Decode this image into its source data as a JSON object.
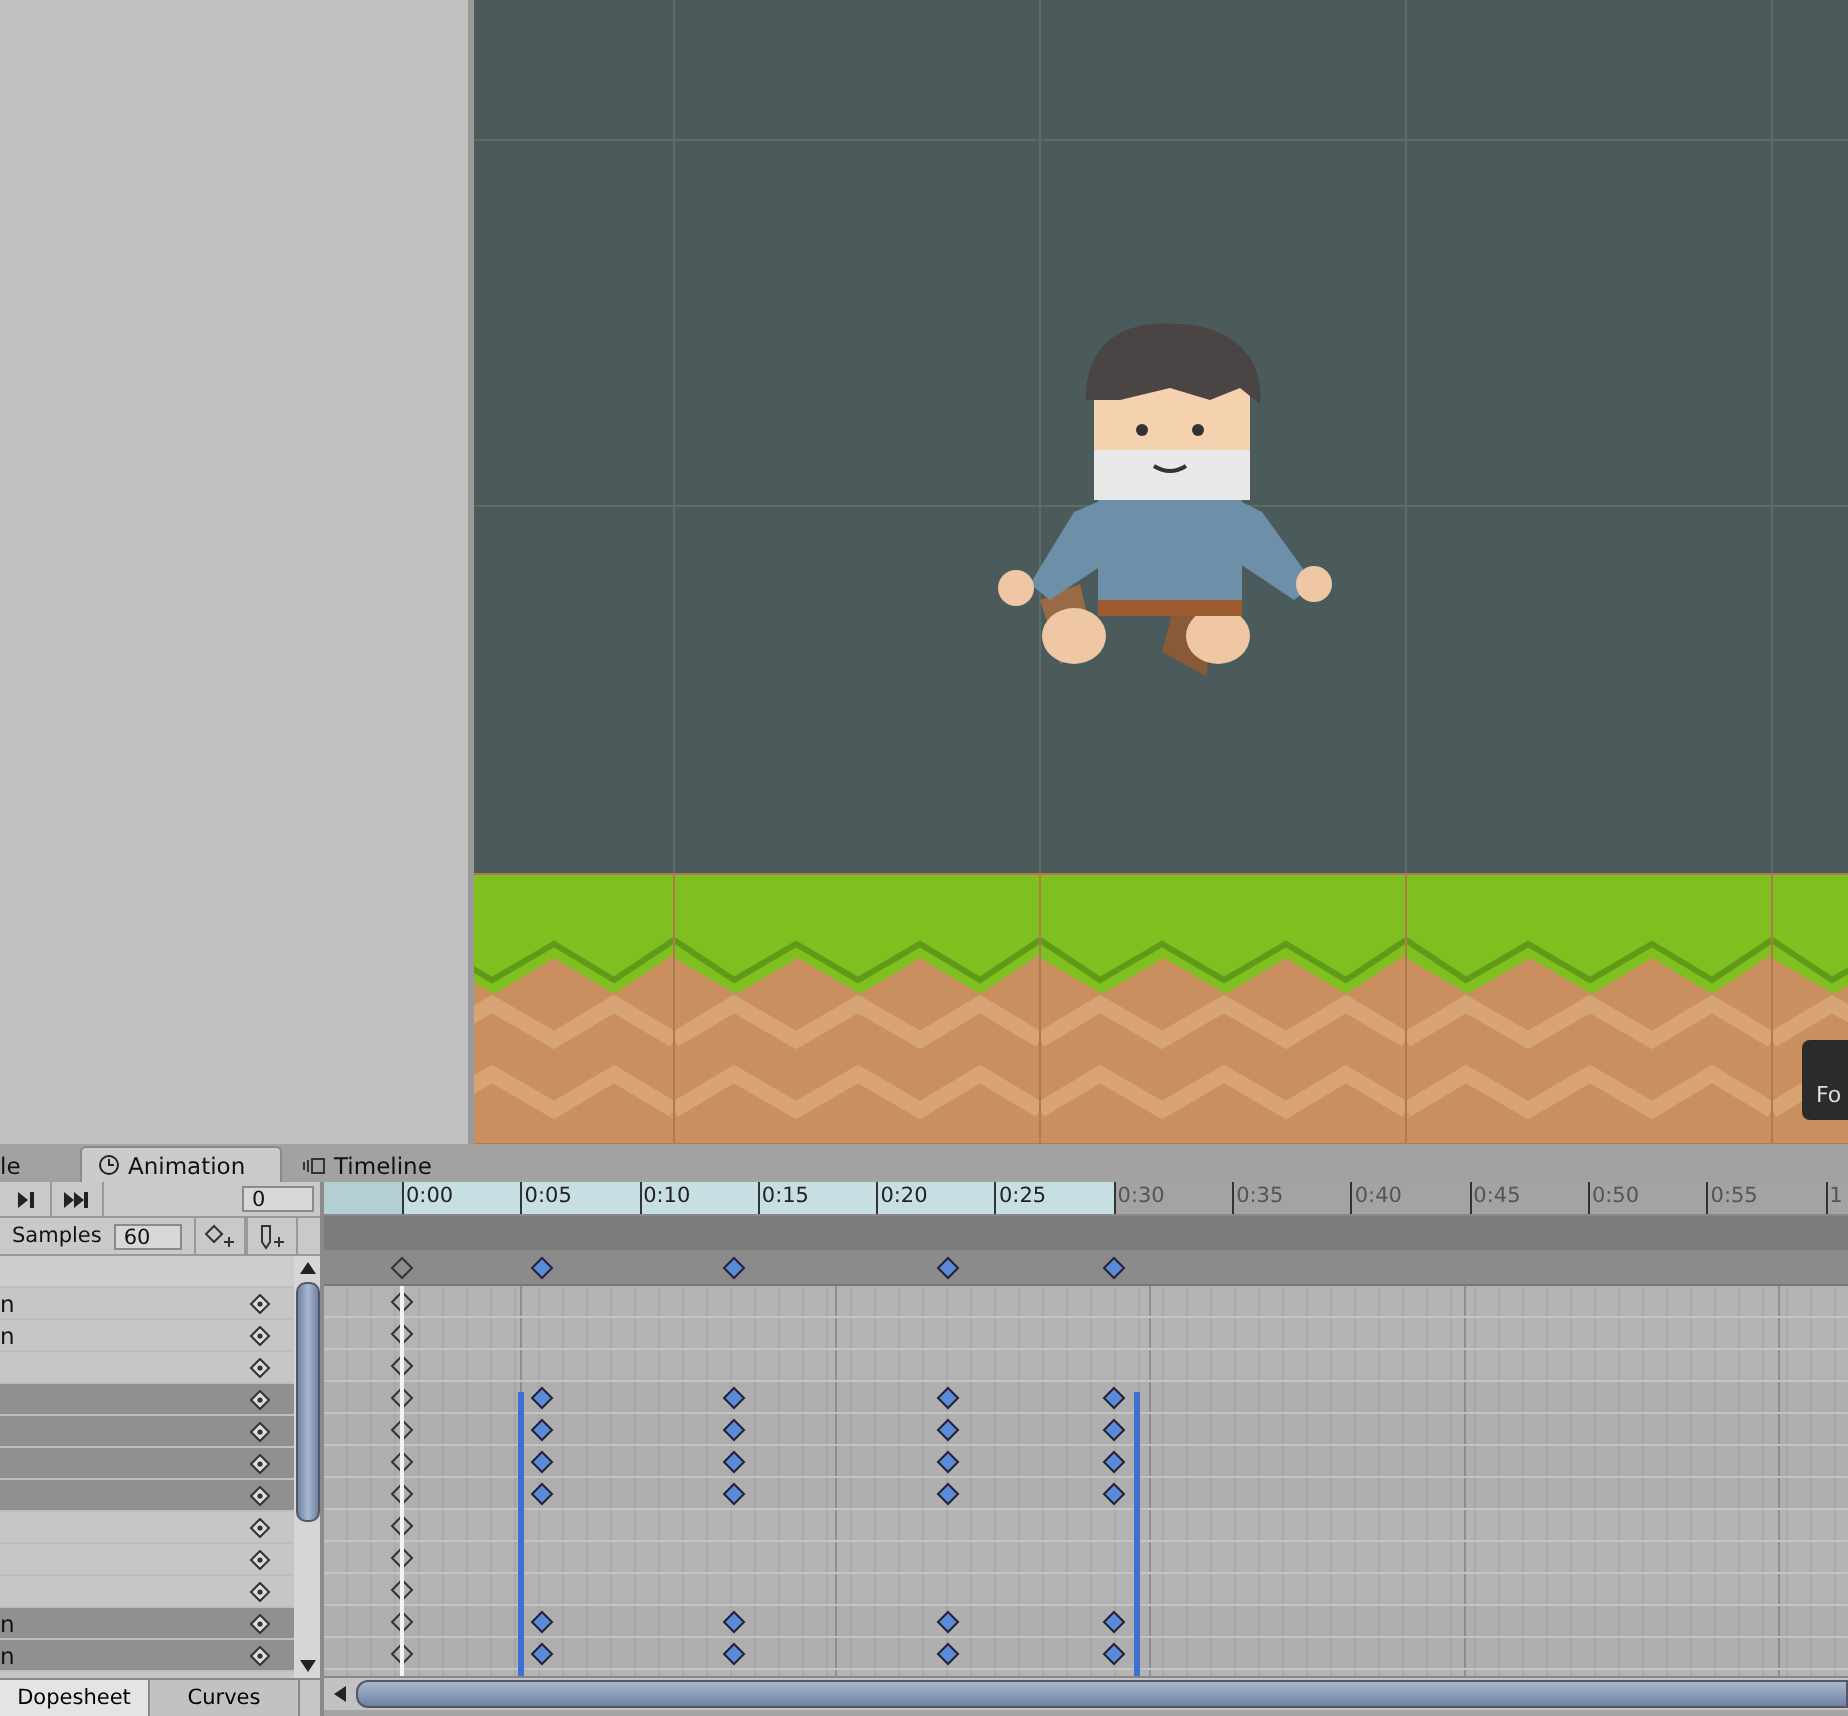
{
  "scene": {
    "tooltip": "Fo"
  },
  "tabs": [
    {
      "label": "le",
      "kind": "plain",
      "selected": false
    },
    {
      "label": "Animation",
      "kind": "clock",
      "selected": true
    },
    {
      "label": "Timeline",
      "kind": "timeline",
      "selected": false
    }
  ],
  "toolbar": {
    "frame": "0",
    "samples_label": "Samples",
    "samples": "60"
  },
  "ruler": [
    {
      "text": "0:00",
      "in_clip": true
    },
    {
      "text": "0:05",
      "in_clip": true
    },
    {
      "text": "0:10",
      "in_clip": true
    },
    {
      "text": "0:15",
      "in_clip": true
    },
    {
      "text": "0:20",
      "in_clip": true
    },
    {
      "text": "0:25",
      "in_clip": true
    },
    {
      "text": "0:30",
      "in_clip": false
    },
    {
      "text": "0:35",
      "in_clip": false
    },
    {
      "text": "0:40",
      "in_clip": false
    },
    {
      "text": "0:45",
      "in_clip": false
    },
    {
      "text": "0:50",
      "in_clip": false
    },
    {
      "text": "0:55",
      "in_clip": false
    },
    {
      "text": "1",
      "in_clip": false
    }
  ],
  "summary": {
    "keyed": true
  },
  "tracks": [
    {
      "label": "n",
      "selected": false,
      "keyed": false
    },
    {
      "label": "n",
      "selected": false,
      "keyed": false
    },
    {
      "selected": false,
      "keyed": false
    },
    {
      "selected": true,
      "keyed": true
    },
    {
      "selected": true,
      "keyed": true
    },
    {
      "selected": true,
      "keyed": true
    },
    {
      "selected": true,
      "keyed": true
    },
    {
      "selected": false,
      "keyed": false
    },
    {
      "selected": false,
      "keyed": false
    },
    {
      "selected": false,
      "keyed": false
    },
    {
      "label": "n",
      "selected": true,
      "keyed": true
    },
    {
      "label": "n",
      "selected": true,
      "keyed": true
    }
  ],
  "view_buttons": [
    {
      "label": "Dopesheet",
      "selected": true
    },
    {
      "label": "Curves",
      "selected": false
    }
  ]
}
